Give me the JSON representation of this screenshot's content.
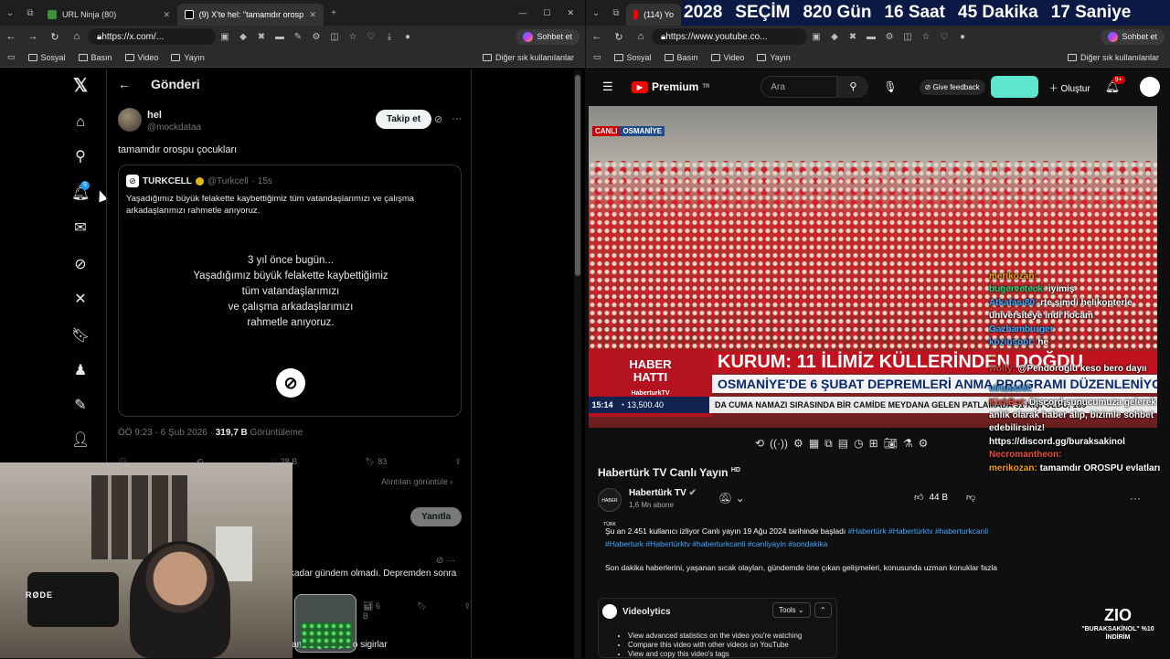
{
  "left_window": {
    "tabs": [
      {
        "label": "URL Ninja (80)"
      },
      {
        "label": "(9) X'te hel: \"tamamdır orospu ço..."
      }
    ],
    "url": "https://x.com/...",
    "copilot": "Sohbet et",
    "bookmarks": [
      "Sosyal",
      "Basın",
      "Video",
      "Yayın"
    ],
    "other_bookmarks": "Diğer sık kullanılanlar"
  },
  "x": {
    "header": "Gönderi",
    "nav_icons": [
      "x-logo-icon",
      "home-icon",
      "search-icon",
      "bell-icon",
      "mail-icon",
      "grok-icon",
      "x-icon",
      "bookmark-icon",
      "communities-icon",
      "premium-icon",
      "profile-icon"
    ],
    "notification_count": "9",
    "post": {
      "name": "hel",
      "handle": "@mockdataa",
      "follow": "Takip et",
      "text": "tamamdır orospu çocukları",
      "quote": {
        "name": "TURKCELL",
        "handle": "@Turkcell",
        "time": "· 15s",
        "text": "Yaşadığımız büyük felakette kaybettiğimiz tüm vatandaşlarımızı ve çalışma arkadaşlarımızı rahmetle anıyoruz.",
        "image_lines": [
          "3 yıl önce bugün...",
          "Yaşadığımız büyük felakette kaybettiğimiz",
          "tüm vatandaşlarımızı",
          "ve çalışma arkadaşlarımızı",
          "rahmetle anıyoruz."
        ]
      },
      "time": "ÖÖ 9:23 · 6 Şub 2026 ·",
      "views": "319,7 B",
      "views_label": "Görüntüleme",
      "likes": "28 B",
      "bookmarks": "83",
      "quotes_link": "Alıntıları görüntüle",
      "reply_button": "Yanıtla"
    },
    "replies": [
      {
        "text": "kadar gündem olmadı. Depremden sonra",
        "views": "6 B"
      },
      {
        "text": "lam degil miydi o sigirlar"
      }
    ]
  },
  "webcam": {
    "mic_brand": "RØDE"
  },
  "right_window": {
    "tab": "(114) Yo",
    "url": "https://www.youtube.co...",
    "copilot": "Sohbet et",
    "bookmarks": [
      "Sosyal",
      "Basın",
      "Video",
      "Yayın"
    ],
    "other_bookmarks": "Diğer sık kullanılanlar",
    "countdown": [
      "2028",
      "SEÇİM",
      "820 Gün",
      "16 Saat",
      "45 Dakika",
      "17 Saniye"
    ]
  },
  "youtube": {
    "logo": "Premium",
    "logo_region": "TR",
    "search_placeholder": "Ara",
    "feedback": "Give feedback",
    "create": "Oluştur",
    "notif_count": "9+",
    "video": {
      "live_badge": "CANLI",
      "location": "OSMANİYE",
      "haber_hatti": "HABER HATTI",
      "handle": "HaberturkTV",
      "headline": "KURUM: 11 İLİMİZ KÜLLERİNDEN DOĞDU",
      "subheadline": "OSMANİYE'DE 6 ŞUBAT DEPREMLERİ ANMA PROGRAMI DÜZENLENİYOR",
      "ticker_time": "15:14",
      "bist": "13,500.40",
      "ticker": "DA CUMA NAMAZI SIRASINDA BİR CAMİDE MEYDANA GELEN PATLAMADA 31 KİŞİ ÖLDÜ, 169"
    },
    "title": "Habertürk TV Canlı Yayın",
    "title_badge": "HD",
    "channel": "Habertürk TV",
    "channel_avatar": "HABER TÜRK",
    "subscribers": "1,6 Mn abone",
    "likes": "44 B",
    "desc_line1": "Şu an 2.451 kullanıcı izliyor  Canlı yayın 19 Ağu 2024 tarihinde başladı",
    "desc_tags1": "#Habertürk #Habertürktv #haberturkcanli",
    "desc_tags2": "#Haberturk #Habertürktv #haberturkcanli #canliyayin #sondakika",
    "desc_line3": "Son dakika haberlerini, yaşanan sıcak olayları, gündemde öne çıkan gelişmeleri, konusunda uzman konuklar                                    fazla",
    "videolytics": {
      "title": "Videolytics",
      "tools": "Tools",
      "items": [
        "View advanced statistics on the video you're watching",
        "Compare this video with other videos on YouTube",
        "View and copy this video's tags"
      ]
    }
  },
  "chat": [
    {
      "user": "merikozan:",
      "text": "",
      "color": "orange"
    },
    {
      "user": "bugerveteck:",
      "text": "iyimiş",
      "color": "green"
    },
    {
      "user": "Atkafası80:",
      "text": "rte şimdi helikopterle üniversiteye indi hocam",
      "color": "blue"
    },
    {
      "user": "Gazhamburger",
      "text": "",
      "color": "blue"
    },
    {
      "user": "koziuspor:",
      "text": "he",
      "color": "blue"
    },
    {
      "user": "...",
      "text": "",
      "color": "orange"
    },
    {
      "user": "wolfy:",
      "text": "@Pendoroglu keso bero dayıı",
      "color": "red"
    },
    {
      "user": "virtuscivi:",
      "text": "",
      "color": "blue"
    },
    {
      "user": "KickBot:",
      "text": "Discord sunucumuza gelerek anlık olarak haber alıp, bizimle sohbet edebilirsiniz! https://discord.gg/buraksakinol",
      "color": "red"
    },
    {
      "user": "Necromantheon:",
      "text": "",
      "color": "red"
    },
    {
      "user": "merikozan:",
      "text": "tamamdır OROSPU evlatları",
      "color": "orange"
    }
  ],
  "overlay": {
    "logo": "ZIO",
    "promo": "\"BURAKSAKİNOL\" %10 İNDİRİM"
  }
}
